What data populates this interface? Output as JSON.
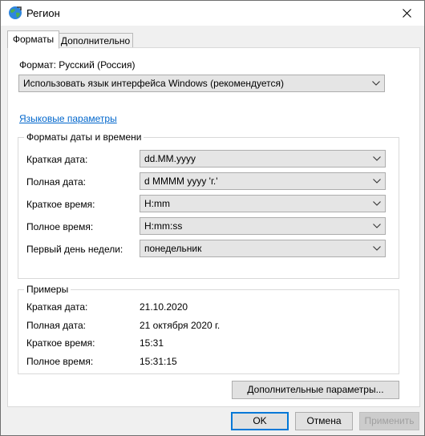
{
  "window": {
    "title": "Регион",
    "icons": {
      "app": "globe-icon",
      "close": "close-icon"
    }
  },
  "tabs": [
    {
      "label": "Форматы",
      "active": true
    },
    {
      "label": "Дополнительно",
      "active": false
    }
  ],
  "format": {
    "label": "Формат: Русский (Россия)",
    "value": "Использовать язык интерфейса Windows (рекомендуется)"
  },
  "lang_link": "Языковые параметры",
  "datetime": {
    "title": "Форматы даты и времени",
    "rows": [
      {
        "label": "Краткая дата:",
        "value": "dd.MM.yyyy"
      },
      {
        "label": "Полная дата:",
        "value": "d MMMM yyyy 'г.'"
      },
      {
        "label": "Краткое время:",
        "value": "H:mm"
      },
      {
        "label": "Полное время:",
        "value": "H:mm:ss"
      },
      {
        "label": "Первый день недели:",
        "value": "понедельник"
      }
    ]
  },
  "examples": {
    "title": "Примеры",
    "rows": [
      {
        "label": "Краткая дата:",
        "value": "21.10.2020"
      },
      {
        "label": "Полная дата:",
        "value": "21 октября 2020 г."
      },
      {
        "label": "Краткое время:",
        "value": "15:31"
      },
      {
        "label": "Полное время:",
        "value": "15:31:15"
      }
    ]
  },
  "buttons": {
    "advanced": "Дополнительные параметры...",
    "ok": "OK",
    "cancel": "Отмена",
    "apply": "Применить"
  }
}
